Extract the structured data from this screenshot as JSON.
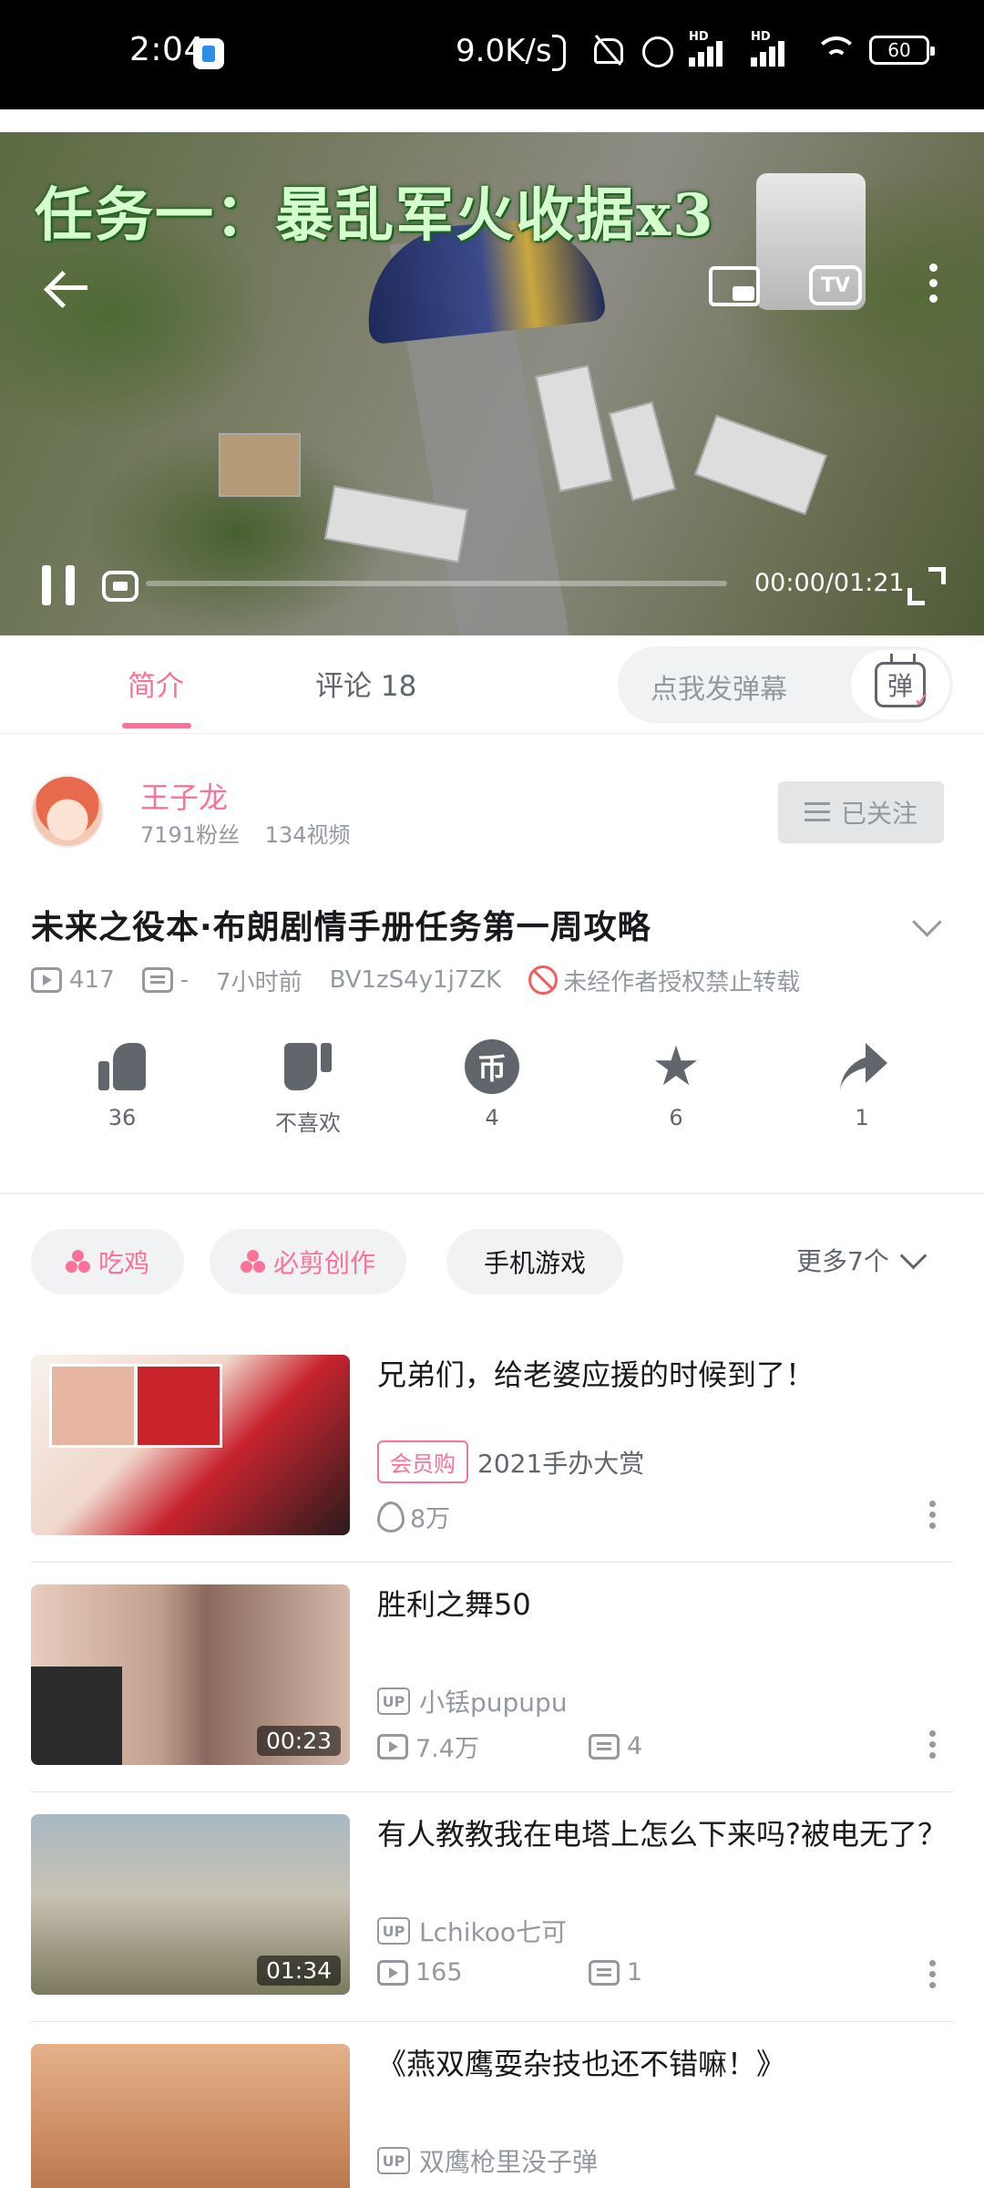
{
  "status_bar": {
    "time": "2:04",
    "net_speed": "9.0K/s",
    "signal_label_1": "HD",
    "signal_label_2": "HD",
    "battery": "60"
  },
  "player": {
    "overlay_title": "任务一：暴乱军火收据x3",
    "tv_label": "TV",
    "time_current": "00:00",
    "time_total": "01:21",
    "progress": 0.0
  },
  "tabs": {
    "intro": "简介",
    "comments": "评论 18",
    "danmaku_placeholder": "点我发弹幕",
    "danmaku_button": "弹"
  },
  "uploader": {
    "name": "王子龙",
    "fans": "7191粉丝",
    "videos": "134视频",
    "follow_label": "已关注"
  },
  "video": {
    "title": "未来之役本·布朗剧情手册任务第一周攻略",
    "views": "417",
    "danmaku": "-",
    "time_ago": "7小时前",
    "bvid": "BV1zS4y1j7ZK",
    "copyright": "未经作者授权禁止转载"
  },
  "actions": {
    "like": "36",
    "dislike": "不喜欢",
    "coin": "4",
    "coin_glyph": "币",
    "favorite": "6",
    "share": "1"
  },
  "tags": {
    "items": [
      "吃鸡",
      "必剪创作",
      "手机游戏"
    ],
    "more": "更多7个"
  },
  "feed": [
    {
      "title": "兄弟们，给老婆应援的时候到了！",
      "badge": "会员购",
      "subtitle": "2021手办大赏",
      "stat": "8万"
    },
    {
      "title": "胜利之舞50",
      "duration": "00:23",
      "up_badge": "UP",
      "author": "小铥pupupu",
      "views": "7.4万",
      "danmaku": "4"
    },
    {
      "title": "有人教教我在电塔上怎么下来吗?被电无了？",
      "duration": "01:34",
      "up_badge": "UP",
      "author": "Lchikoo七可",
      "views": "165",
      "danmaku": "1"
    },
    {
      "title": "《燕双鹰耍杂技也还不错嘛！》",
      "up_badge": "UP",
      "author": "双鹰枪里没子弹"
    }
  ],
  "colors": {
    "accent": "#fb7299",
    "text": "#18191c",
    "muted": "#9499a0"
  }
}
